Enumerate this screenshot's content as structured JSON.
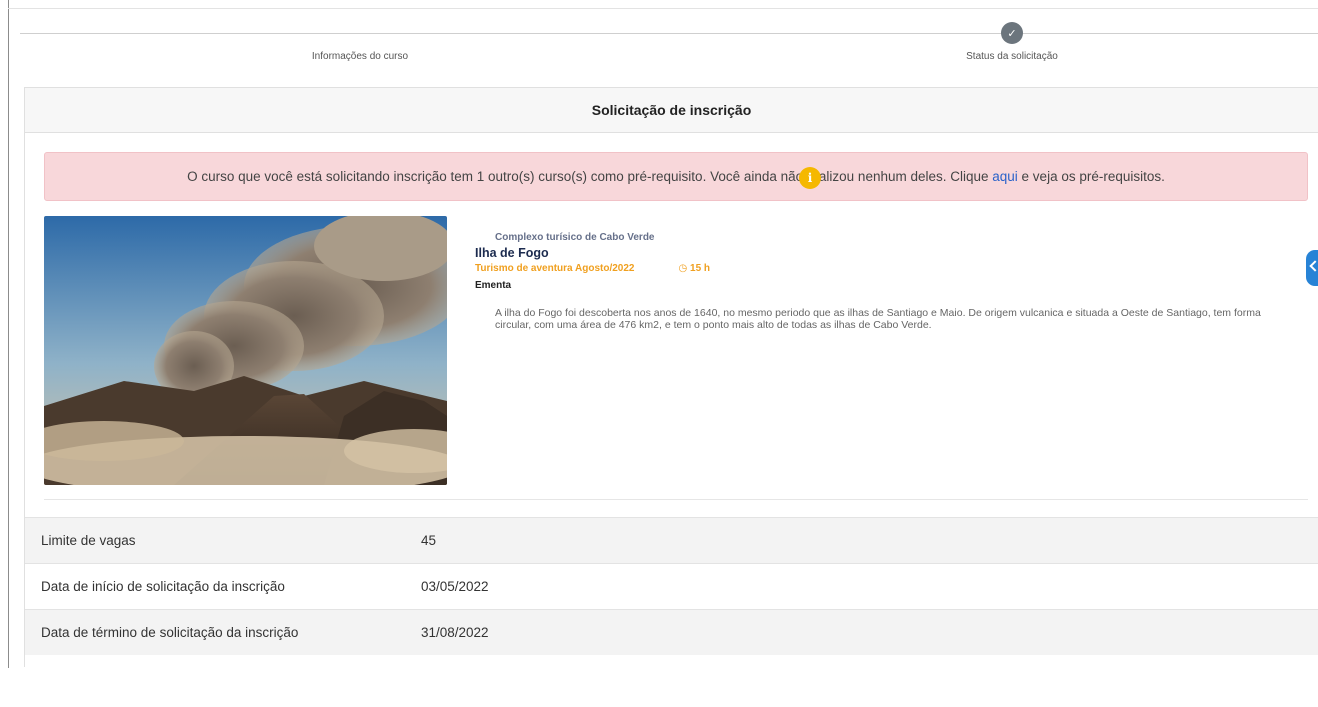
{
  "stepper": {
    "steps": [
      {
        "label": "Informações do curso",
        "icon": "info-icon",
        "state": "current",
        "color": "#f5b800"
      },
      {
        "label": "Status da solicitação",
        "icon": "check-icon",
        "state": "pending",
        "color": "#6c757d"
      }
    ]
  },
  "card": {
    "title": "Solicitação de inscrição"
  },
  "alert": {
    "text_before": "O curso que você está solicitando inscrição tem 1 outro(s) curso(s) como pré-requisito. Você ainda não realizou nenhum deles. Clique ",
    "link_text": "aqui",
    "text_after": " e veja os pré-requisitos.",
    "background": "#f8d7da"
  },
  "course": {
    "institution": "Complexo turísico de Cabo Verde",
    "title": "Ilha de Fogo",
    "category_period": "Turismo de aventura Agosto/2022",
    "hours": "15 h",
    "section_label": "Ementa",
    "description": "A ilha do Fogo foi descoberta nos anos de 1640, no mesmo periodo que as ilhas de Santiago e Maio. De origem vulcanica e situada a Oeste de Santiago, tem forma circular, com uma área de 476 km2, e tem o ponto mais alto de todas as ilhas de Cabo Verde.",
    "accent_color": "#f0a020"
  },
  "details": [
    {
      "label": "Limite de vagas",
      "value": "45"
    },
    {
      "label": "Data de início de solicitação da inscrição",
      "value": "03/05/2022"
    },
    {
      "label": "Data de término de solicitação da inscrição",
      "value": "31/08/2022"
    }
  ]
}
